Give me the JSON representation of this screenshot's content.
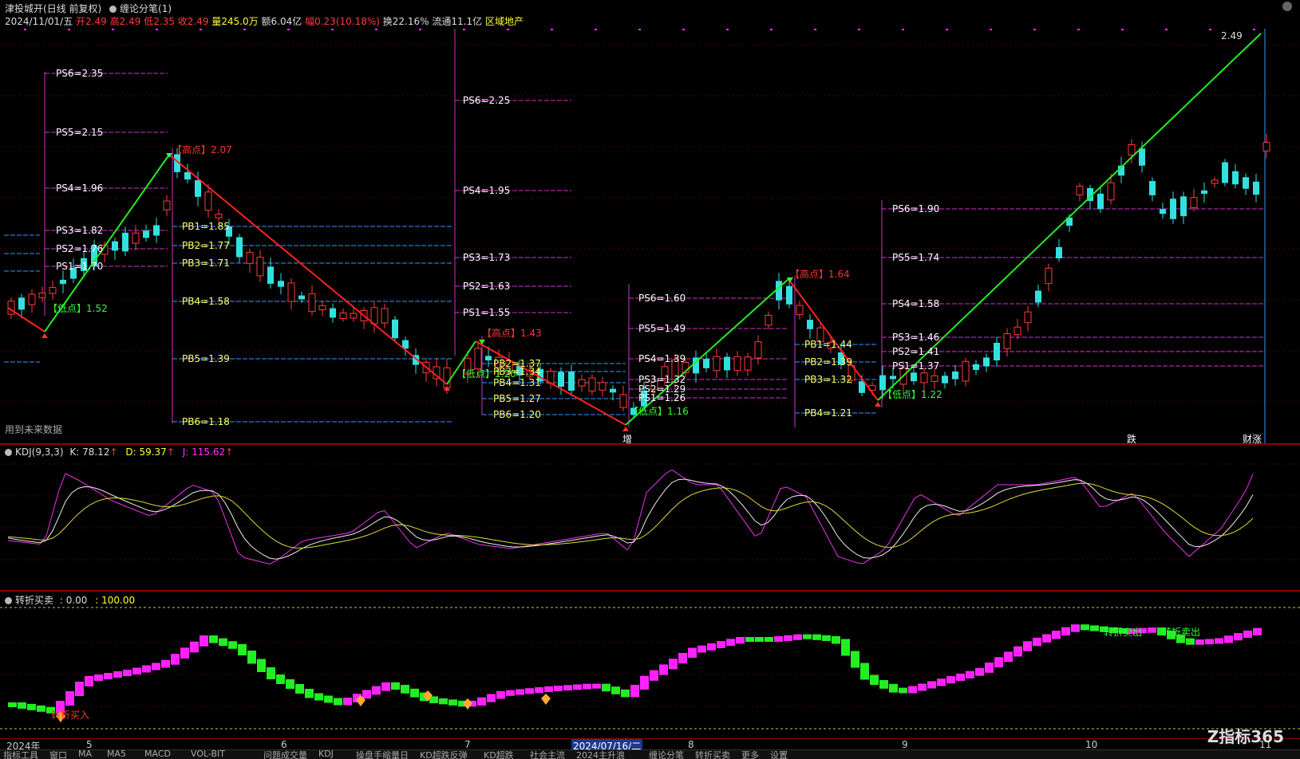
{
  "header": {
    "stock_name": "津投城开",
    "period": "(日线 前复权)",
    "indicator_name": "缠论分笔(1)",
    "date": "2024/11/01/五",
    "open_label": "开",
    "open": "2.49",
    "high_label": "高",
    "high": "2.49",
    "low_label": "低",
    "low": "2.35",
    "close_label": "收",
    "close": "2.49",
    "volume_label": "量",
    "volume": "245.0万",
    "amount_label": "额",
    "amount": "6.04亿",
    "change_label": "幅",
    "change": "0.23(10.18%)",
    "turnover_label": "换",
    "turnover": "22.16%",
    "float_label": "流通",
    "float_value": "11.1亿",
    "sector": "区域地产"
  },
  "main_chart": {
    "future_text": "用到未来数据",
    "price_label_right": "2.49",
    "bottom_marks": [
      "增",
      "跌",
      "财涨"
    ],
    "levels": [
      {
        "text": "PS6=2.35",
        "color": "#ffffff"
      },
      {
        "text": "PS5=2.15",
        "color": "#ffffff"
      },
      {
        "text": "PS4=1.96",
        "color": "#ffffff"
      },
      {
        "text": "PS3=1.82",
        "color": "#ffffff"
      },
      {
        "text": "PS2=1.76",
        "color": "#ffffff"
      },
      {
        "text": "PS1=1.70",
        "color": "#ffffff"
      },
      {
        "text": "PB1=1.85",
        "color": "#ffff66"
      },
      {
        "text": "PB2=1.77",
        "color": "#ffff66"
      },
      {
        "text": "PB3=1.71",
        "color": "#ffff66"
      },
      {
        "text": "PB4=1.58",
        "color": "#ffff66"
      },
      {
        "text": "PB5=1.39",
        "color": "#ffff66"
      },
      {
        "text": "PB6=1.18",
        "color": "#ffff66"
      },
      {
        "text": "PS6=2.25",
        "color": "#ffffff"
      },
      {
        "text": "PS4=1.95",
        "color": "#ffffff"
      },
      {
        "text": "PS3=1.73",
        "color": "#ffffff"
      },
      {
        "text": "PS2=1.63",
        "color": "#ffffff"
      },
      {
        "text": "PS1=1.55",
        "color": "#ffffff"
      },
      {
        "text": "PB2=1.37",
        "color": "#ffff66"
      },
      {
        "text": "PB3=1.34",
        "color": "#ffff66"
      },
      {
        "text": "PB4=1.31",
        "color": "#ffff66"
      },
      {
        "text": "PB5=1.27",
        "color": "#ffff66"
      },
      {
        "text": "PB6=1.20",
        "color": "#ffff66"
      },
      {
        "text": "PS6=1.60",
        "color": "#ffffff"
      },
      {
        "text": "PS5=1.49",
        "color": "#ffffff"
      },
      {
        "text": "PS4=1.39",
        "color": "#ffffff"
      },
      {
        "text": "PS3=1.32",
        "color": "#ffffff"
      },
      {
        "text": "PS2=1.29",
        "color": "#ffffff"
      },
      {
        "text": "PS1=1.26",
        "color": "#ffffff"
      },
      {
        "text": "PB1=1.44",
        "color": "#ffff66"
      },
      {
        "text": "PB2=1.39",
        "color": "#ffff66"
      },
      {
        "text": "PB3=1.32",
        "color": "#ffff66"
      },
      {
        "text": "PB4=1.21",
        "color": "#ffff66"
      },
      {
        "text": "PS6=1.90",
        "color": "#ffffff"
      },
      {
        "text": "PS5=1.74",
        "color": "#ffffff"
      },
      {
        "text": "PS4=1.58",
        "color": "#ffffff"
      },
      {
        "text": "PS3=1.46",
        "color": "#ffffff"
      },
      {
        "text": "PS2=1.41",
        "color": "#ffffff"
      },
      {
        "text": "PS1=1.37",
        "color": "#ffffff"
      }
    ],
    "pivots": [
      {
        "text": "【低点】1.52",
        "color": "#33ff33"
      },
      {
        "text": "【高点】2.07",
        "color": "#ff3333"
      },
      {
        "text": "【低点】1.20",
        "color": "#33ff33"
      },
      {
        "text": "【高点】1.43",
        "color": "#ff3333"
      },
      {
        "text": "【低点】1.16",
        "color": "#33ff33"
      },
      {
        "text": "【高点】1.64",
        "color": "#ff3333"
      },
      {
        "text": "【低点】1.22",
        "color": "#33ff33"
      }
    ]
  },
  "kdj": {
    "name": "KDJ(9,3,3)",
    "k_label": "K: 78.12",
    "d_label": "D: 59.37",
    "j_label": "J: 115.62",
    "arrow": "↑"
  },
  "zhuanzhe": {
    "name": "转折买卖",
    "value1": ": 0.00",
    "value2": ": 100.00",
    "buy_label": "转折买入",
    "sell_label_1": "转折卖出",
    "sell_label_2": "转折卖出"
  },
  "axis": {
    "labels": [
      "2024年",
      "5",
      "6",
      "7",
      "2024/07/16/二",
      "8",
      "9",
      "10",
      "11"
    ]
  },
  "tabs": [
    "指标工具",
    "窗口",
    "MA",
    "MA5",
    "MACD",
    "VOL-BIT",
    "问题成交量",
    "KDJ",
    "操盘手缩量日",
    "KD超跌反弹",
    "KD超跌",
    "社会主流",
    "2024主升浪",
    "缠论分笔",
    "转折买卖",
    "更多",
    "设置"
  ],
  "watermark": "Z指标365"
}
